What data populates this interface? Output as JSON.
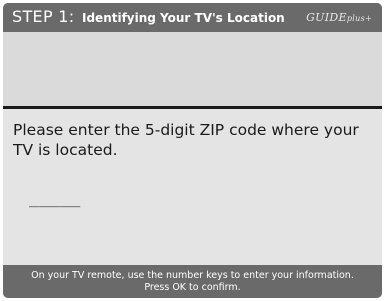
{
  "header": {
    "step_number": "STEP 1:",
    "step_title": "Identifying Your TV's Location",
    "logo_text": "GUIDE",
    "logo_suffix": "plus+"
  },
  "main": {
    "prompt": "Please enter the 5-digit ZIP code where your TV is located.",
    "zip_value": "_____"
  },
  "footer": {
    "line1": "On your TV remote, use the number keys to enter your information.",
    "line2": "Press OK to confirm."
  },
  "colors": {
    "header_bg": "#6a6a6a",
    "panel_bg": "#e4e4e4",
    "divider": "#1a1a1a",
    "text": "#1a1a1a"
  }
}
